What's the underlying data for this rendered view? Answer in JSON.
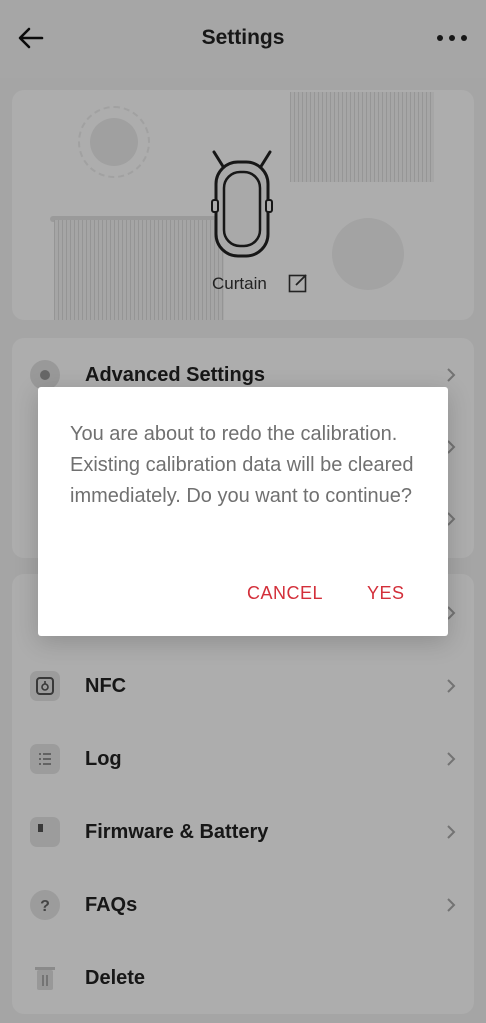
{
  "header": {
    "title": "Settings",
    "back_icon": "arrow-left-icon",
    "more_icon": "more-horizontal-icon"
  },
  "device": {
    "name": "Curtain",
    "icon": "curtain-device-icon",
    "edit_icon": "edit-icon"
  },
  "menu_primary": [
    {
      "label": "Advanced Settings",
      "icon": "gear-icon"
    }
  ],
  "menu_secondary": [
    {
      "label": "NFC",
      "icon": "nfc-icon"
    },
    {
      "label": "Log",
      "icon": "log-list-icon"
    },
    {
      "label": "Firmware & Battery",
      "icon": "firmware-icon"
    },
    {
      "label": "FAQs",
      "icon": "question-icon"
    },
    {
      "label": "Delete",
      "icon": "trash-icon"
    }
  ],
  "dialog": {
    "message": "You are about to redo the calibration. Existing calibration data will be cleared immediately. Do you want to continue?",
    "cancel_label": "CANCEL",
    "confirm_label": "YES"
  },
  "colors": {
    "accent": "#d32f3a",
    "scrim": "rgba(0,0,0,0.32)",
    "background": "#f3f3f3"
  }
}
